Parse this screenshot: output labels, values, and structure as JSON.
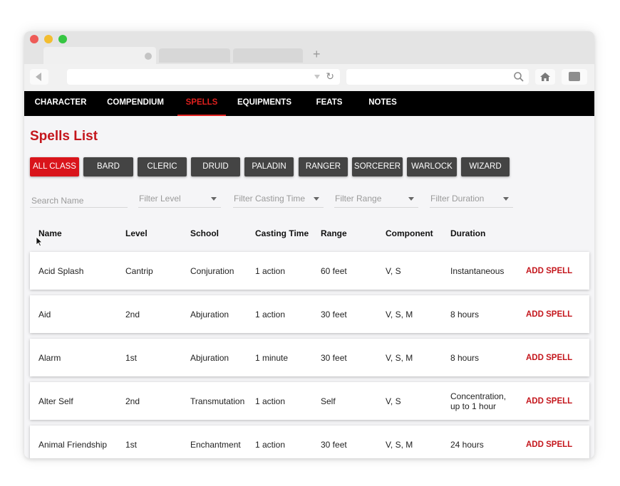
{
  "nav": {
    "items": [
      "CHARACTER",
      "COMPENDIUM",
      "SPELLS",
      "EQUIPMENTS",
      "FEATS",
      "NOTES"
    ],
    "active": "SPELLS"
  },
  "page": {
    "title": "Spells List"
  },
  "classes": {
    "items": [
      "ALL CLASS",
      "BARD",
      "CLERIC",
      "DRUID",
      "PALADIN",
      "RANGER",
      "SORCERER",
      "WARLOCK",
      "WIZARD"
    ],
    "active": "ALL CLASS"
  },
  "filters": {
    "search_placeholder": "Search Name",
    "level": "Filter Level",
    "casting_time": "Filter Casting Time",
    "range": "Filter Range",
    "duration": "Filter Duration"
  },
  "table": {
    "headers": [
      "Name",
      "Level",
      "School",
      "Casting Time",
      "Range",
      "Component",
      "Duration"
    ],
    "action_label": "ADD SPELL",
    "rows": [
      {
        "name": "Acid Splash",
        "level": "Cantrip",
        "school": "Conjuration",
        "casting_time": "1 action",
        "range": "60 feet",
        "component": "V, S",
        "duration": "Instantaneous"
      },
      {
        "name": "Aid",
        "level": "2nd",
        "school": "Abjuration",
        "casting_time": "1 action",
        "range": "30 feet",
        "component": "V, S, M",
        "duration": "8 hours"
      },
      {
        "name": "Alarm",
        "level": "1st",
        "school": "Abjuration",
        "casting_time": "1 minute",
        "range": "30 feet",
        "component": "V, S, M",
        "duration": "8 hours"
      },
      {
        "name": "Alter Self",
        "level": "2nd",
        "school": "Transmutation",
        "casting_time": "1 action",
        "range": "Self",
        "component": "V, S",
        "duration": "Concentration, up to 1 hour"
      },
      {
        "name": "Animal Friendship",
        "level": "1st",
        "school": "Enchantment",
        "casting_time": "1 action",
        "range": "30 feet",
        "component": "V, S, M",
        "duration": "24 hours"
      }
    ]
  },
  "colors": {
    "accent": "#c4161c",
    "nav_bg": "#000000",
    "button_bg": "#444444"
  }
}
